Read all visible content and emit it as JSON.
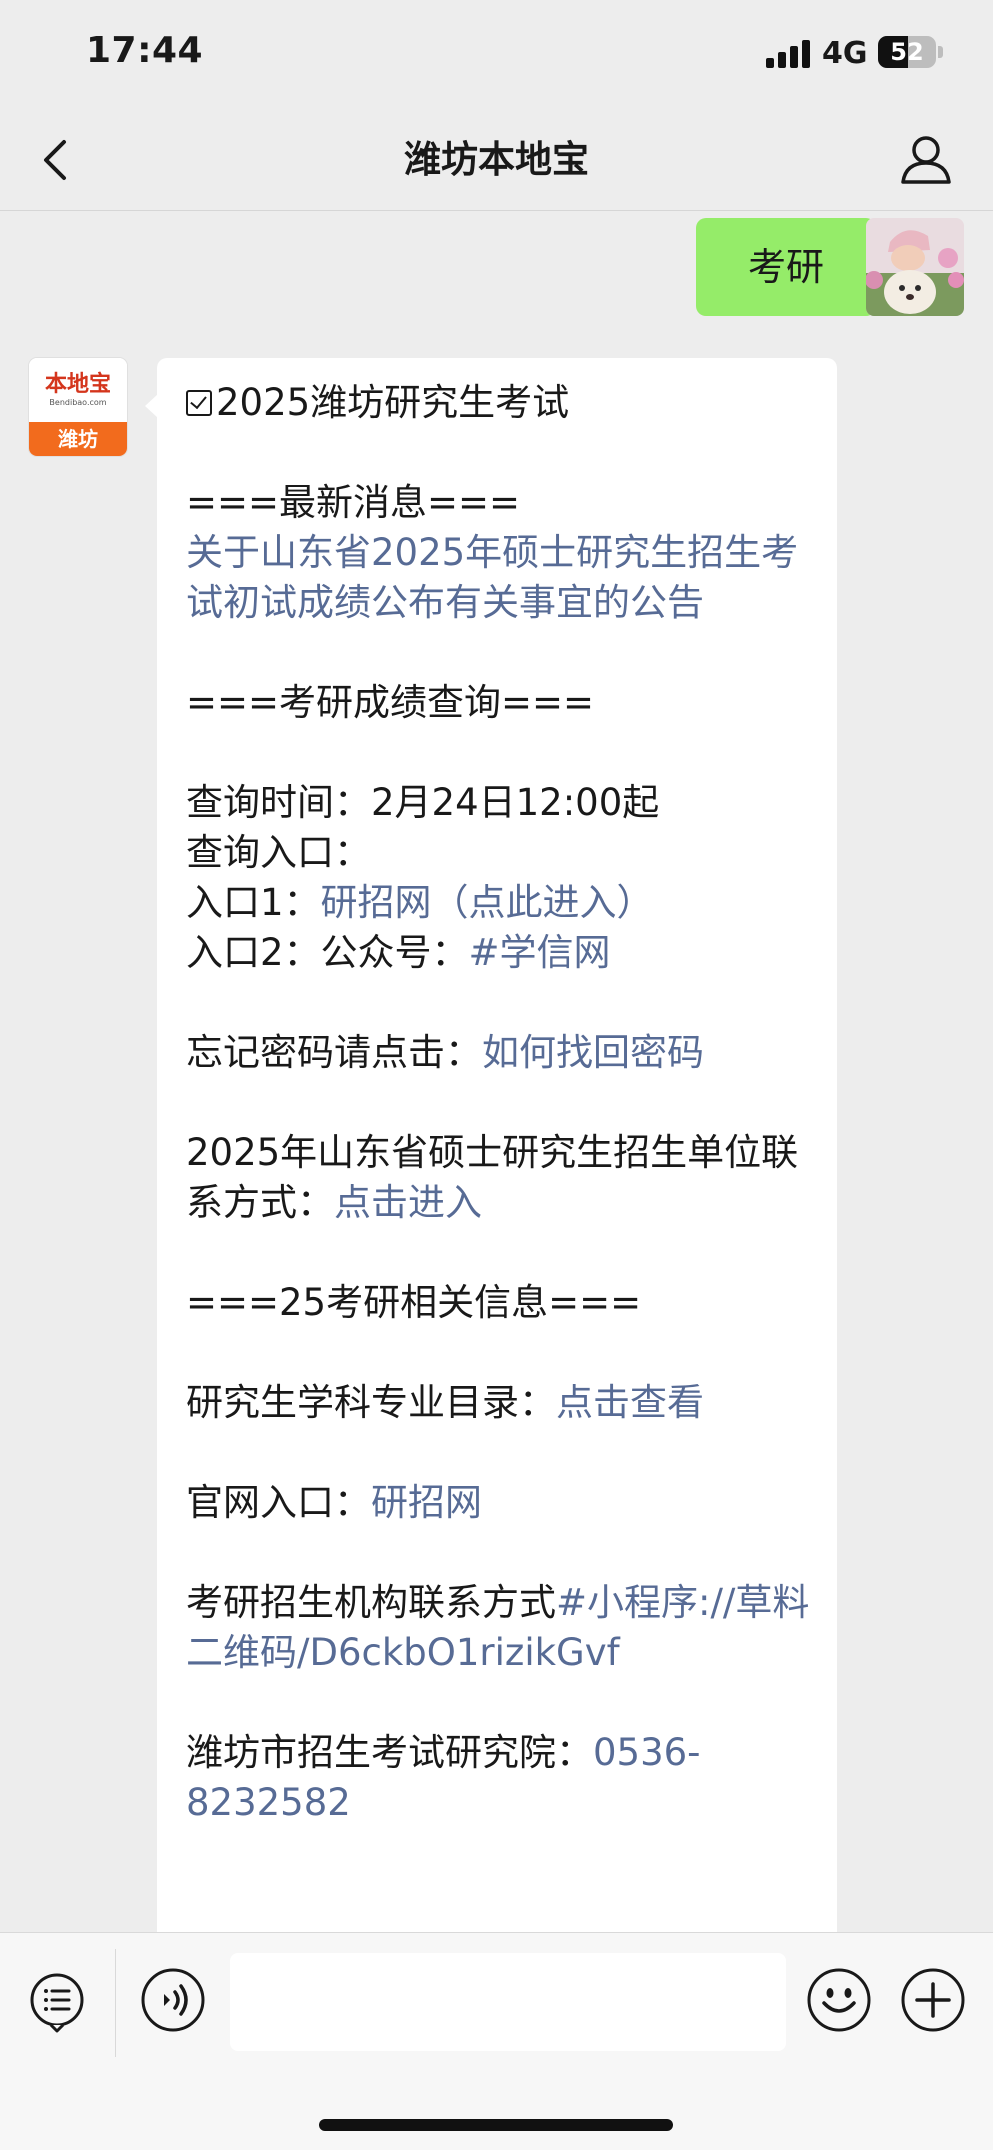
{
  "status_bar": {
    "time": "17:44",
    "network": "4G",
    "battery": "52",
    "battery_level": 0.52
  },
  "nav": {
    "title": "潍坊本地宝",
    "back_icon": "chevron-left-icon",
    "profile_icon": "person-icon"
  },
  "conversation": {
    "outgoing": {
      "text": "考研"
    },
    "incoming_avatar": {
      "brand": "本地宝",
      "sub": "Bendibao.com",
      "city": "潍坊"
    },
    "incoming": {
      "title": "2025潍坊研究生考试",
      "latest_header": "===最新消息===",
      "latest_link": "关于山东省2025年硕士研究生招生考试初试成绩公布有关事宜的公告",
      "score_header": "===考研成绩查询===",
      "query_time": "查询时间：2月24日12:00起",
      "query_entry": "查询入口：",
      "entry1_label": "入口1：",
      "entry1_link": "研招网（点此进入）",
      "entry2_label": "入口2：公众号：",
      "entry2_link": "#学信网",
      "forgot_label": "忘记密码请点击：",
      "forgot_link": "如何找回密码",
      "contact_label": "2025年山东省硕士研究生招生单位联系方式：",
      "contact_link": "点击进入",
      "related_header": "===25考研相关信息===",
      "catalog_label": "研究生学科专业目录：",
      "catalog_link": "点击查看",
      "official_label": "官网入口：",
      "official_link": "研招网",
      "org_label": "考研招生机构联系方式",
      "org_link": "#小程序://草料二维码/D6ckbO1rizikGvf",
      "institute_label": "潍坊市招生考试研究院：",
      "institute_phone": "0536-8232582"
    }
  },
  "input_bar": {
    "menu_icon": "list-menu-icon",
    "voice_icon": "voice-icon",
    "emoji_icon": "smile-icon",
    "plus_icon": "plus-icon",
    "placeholder": ""
  },
  "colors": {
    "background": "#ededed",
    "outgoing_bubble": "#95ec69",
    "link": "#576b95",
    "brand_orange": "#f26b1d"
  }
}
